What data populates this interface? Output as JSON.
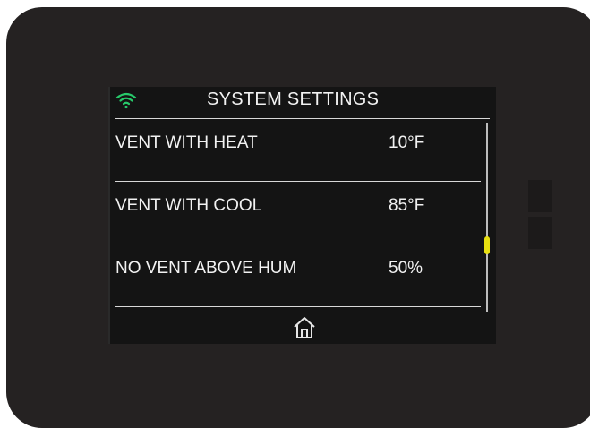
{
  "header": {
    "title": "SYSTEM SETTINGS",
    "wifi_icon": "wifi-icon",
    "wifi_color": "#27c96a"
  },
  "settings": [
    {
      "label": "VENT WITH HEAT",
      "value": "10°F"
    },
    {
      "label": "VENT WITH COOL",
      "value": "85°F"
    },
    {
      "label": "NO VENT ABOVE HUM",
      "value": "50%"
    }
  ],
  "scrollbar": {
    "thumb_color": "#e8e010"
  },
  "footer": {
    "home_icon": "home-icon"
  },
  "colors": {
    "device": "#252222",
    "screen": "#141414",
    "text": "#f2f2f2"
  }
}
